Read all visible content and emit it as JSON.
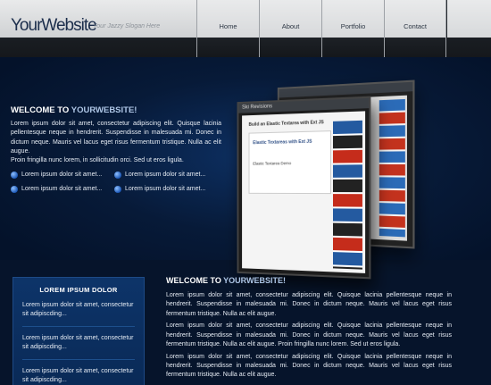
{
  "brand": {
    "logo_part1": "Your",
    "logo_part2": "Website",
    "slogan": "Your Jazzy Slogan Here"
  },
  "nav": {
    "items": [
      "Home",
      "About",
      "Portfolio",
      "Contact"
    ]
  },
  "hero": {
    "title_prefix": "WELCOME TO ",
    "title_highlight": "YOURWEBSITE!",
    "text": "Lorem ipsum dolor sit amet, consectetur adipiscing elit. Quisque lacinia pellentesque neque in hendrerit. Suspendisse in malesuada mi. Donec in dictum neque. Mauris vel lacus eget risus fermentum tristique. Nulla ac elit augue.",
    "text2": "Proin fringilla nunc lorem, in sollicitudin orci. Sed ut eros ligula.",
    "bullets": [
      "Lorem ipsum dolor sit amet...",
      "Lorem ipsum dolor sit amet...",
      "Lorem ipsum dolor sit amet...",
      "Lorem ipsum dolor sit amet..."
    ]
  },
  "screenshot": {
    "front_bar": "Ski Revisions",
    "front_headline": "Build an Elastic Textarea with Ext JS",
    "box_title": "Elastic Textareas with Ext JS",
    "box_sub": "Elastic Textarea Demo"
  },
  "sidebar": {
    "title": "LOREM IPSUM DOLOR",
    "items": [
      "Lorem ipsum dolor sit amet, consectetur sit adipiscding...",
      "Lorem ipsum dolor sit amet, consectetur sit adipiscding...",
      "Lorem ipsum dolor sit amet, consectetur sit adipiscding..."
    ]
  },
  "main": {
    "title_prefix": "WELCOME TO ",
    "title_highlight": "YOURWEBSITE!",
    "paragraphs": [
      "Lorem ipsum dolor sit amet, consectetur adipiscing elit. Quisque lacinia pellentesque neque in hendrerit. Suspendisse in malesuada mi. Donec in dictum neque. Mauris vel lacus eget risus fermentum tristique. Nulla ac elit augue.",
      "Lorem ipsum dolor sit amet, consectetur adipiscing elit. Quisque lacinia pellentesque neque in hendrerit. Suspendisse in malesuada mi. Donec in dictum neque. Mauris vel lacus eget risus fermentum tristique. Nulla ac elit augue. Proin fringilla nunc lorem. Sed ut eros ligula.",
      "Lorem ipsum dolor sit amet, consectetur adipiscing elit. Quisque lacinia pellentesque neque in hendrerit. Suspendisse in malesuada mi. Donec in dictum neque. Mauris vel lacus eget risus fermentum tristique. Nulla ac elit augue."
    ]
  }
}
